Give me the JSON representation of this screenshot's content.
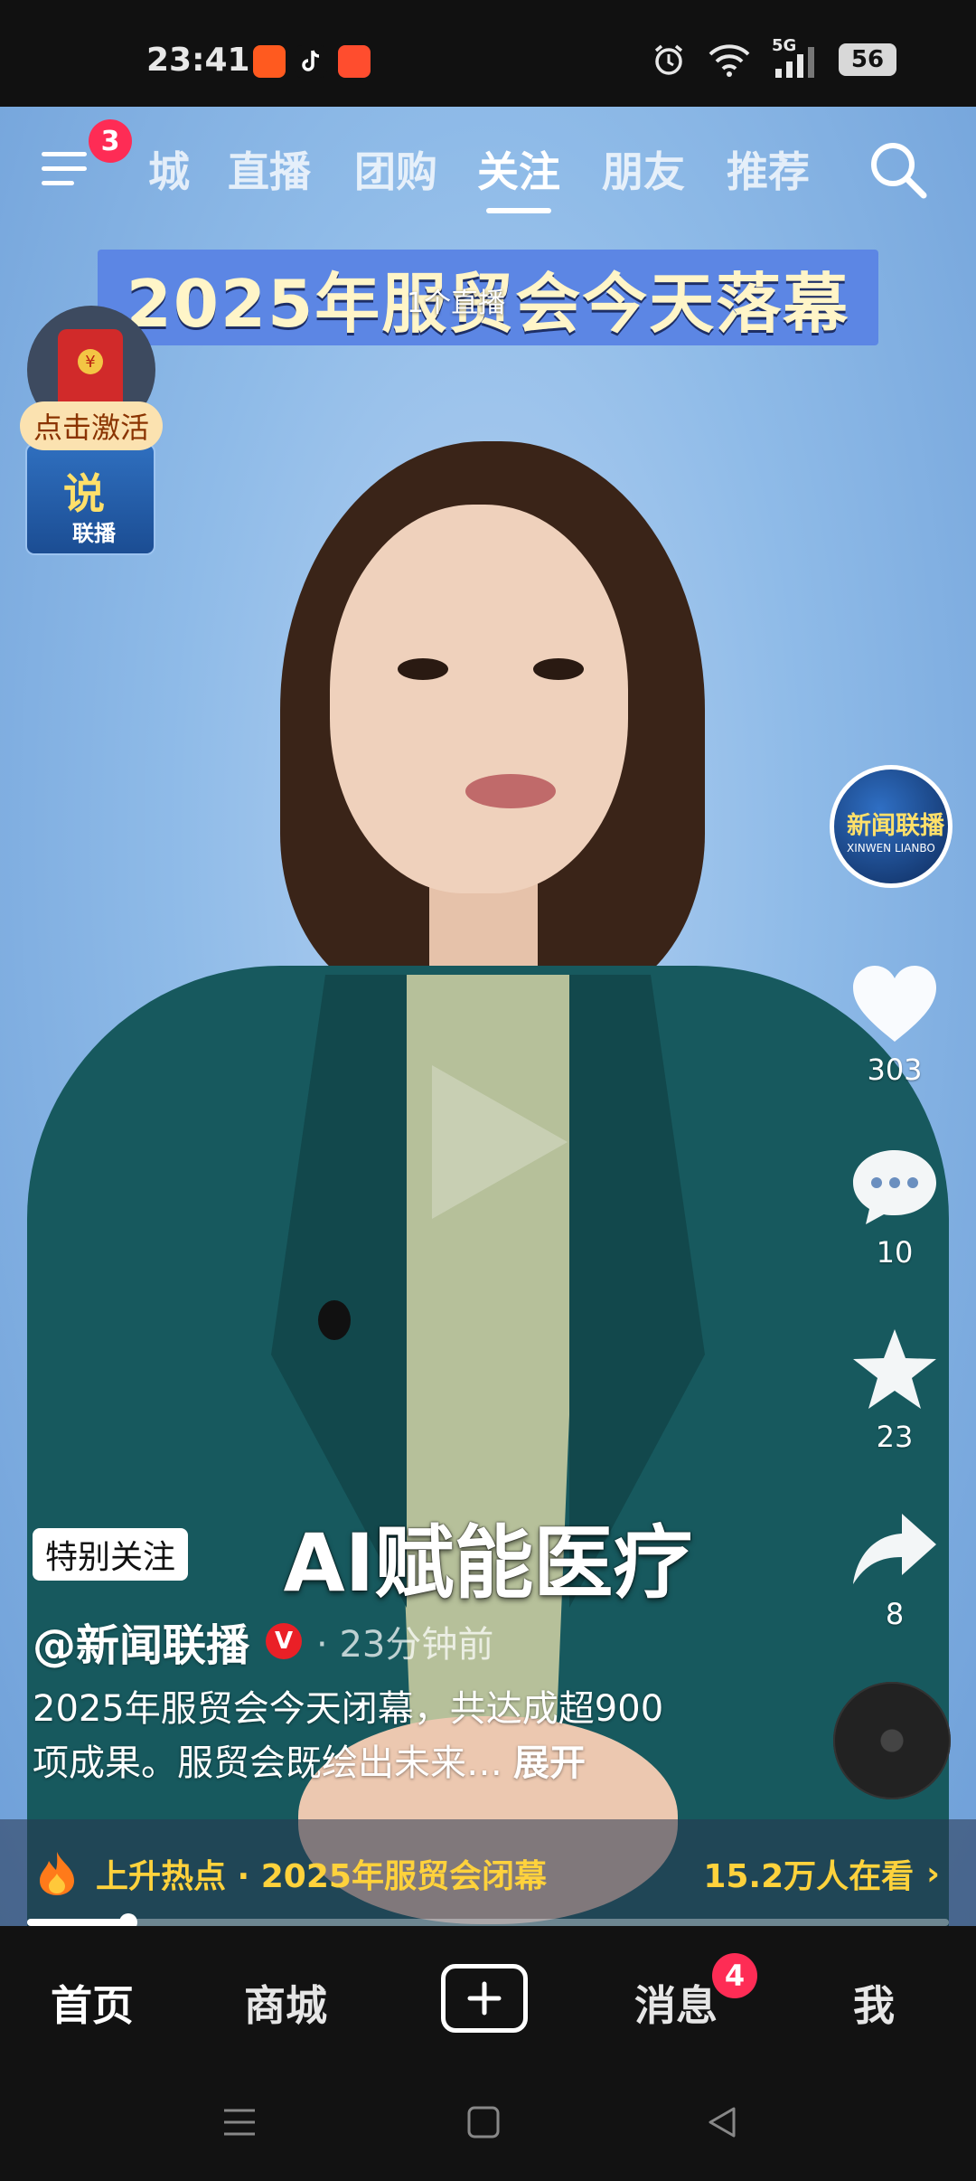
{
  "status_bar": {
    "time": "23:41",
    "network": "5G",
    "battery": "56",
    "app_icons": [
      "app-icon-orange",
      "tiktok-icon",
      "app-icon-red"
    ],
    "right_icons": [
      "alarm-icon",
      "wifi-icon",
      "signal-icon",
      "battery-icon"
    ]
  },
  "top_nav": {
    "menu_badge": "3",
    "tabs": [
      {
        "label": "城"
      },
      {
        "label": "直播"
      },
      {
        "label": "团购"
      },
      {
        "label": "关注"
      },
      {
        "label": "朋友"
      },
      {
        "label": "推荐"
      }
    ],
    "active_tab": "关注"
  },
  "video": {
    "headline": "2025年服贸会今天落幕",
    "live_overlay": "1个直播",
    "subtitle": "AI赋能医疗",
    "widget": {
      "activate_label": "点击激活",
      "logo_big": "说",
      "logo_small": "联播"
    }
  },
  "right_rail": {
    "avatar_text": "新闻联播",
    "avatar_subtext": "XINWEN LIANBO",
    "likes": "303",
    "comments": "10",
    "favorites": "23",
    "shares": "8"
  },
  "post": {
    "special_tag": "特别关注",
    "author": "@新闻联播",
    "verified_mark": "V",
    "time": "· 23分钟前",
    "description_line1": "2025年服贸会今天闭幕，共达成超900",
    "description_line2": "项成果。服贸会既绘出未来…",
    "expand_label": "展开"
  },
  "hot_bar": {
    "text": "上升热点 · 2025年服贸会闭幕",
    "viewers": "15.2万人在看",
    "chevron": "›"
  },
  "progress": {
    "fraction": 0.11
  },
  "bottom_nav": {
    "home": "首页",
    "mall": "商城",
    "messages": "消息",
    "messages_badge": "4",
    "me": "我"
  },
  "colors": {
    "accent": "#fe2c55",
    "hot": "#ffd23c",
    "background": "#121212"
  }
}
